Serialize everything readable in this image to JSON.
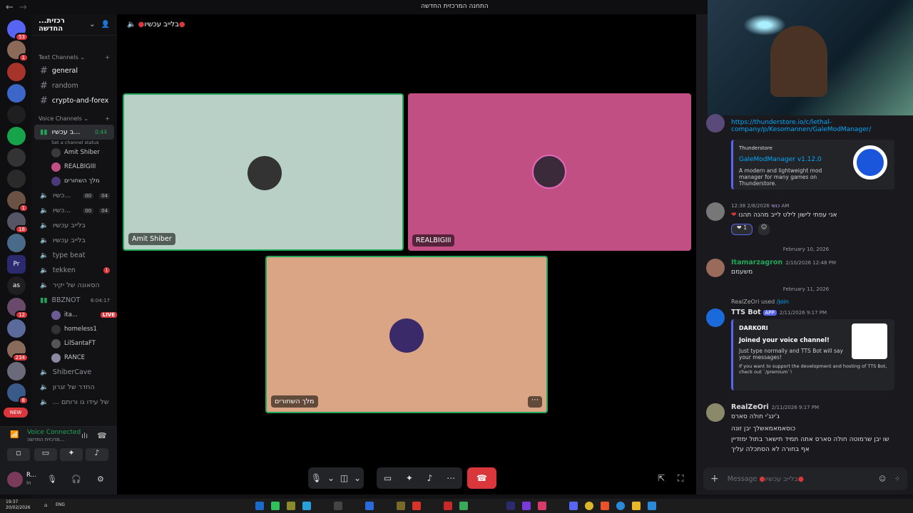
{
  "window": {
    "title": "התחנה המרכזית החדשה"
  },
  "guild_badges": [
    "53",
    "1",
    "1",
    "18",
    "12",
    "234",
    "8"
  ],
  "guild_text": {
    "as": "as",
    "new": "NEW"
  },
  "server": {
    "name": "...רכזית החדשה"
  },
  "categories": {
    "text": "Text Channels",
    "voice": "Voice Channels"
  },
  "text_channels": [
    "general",
    "random",
    "crypto-and-forex"
  ],
  "voice": {
    "active_channel": "ב עכשיו...",
    "active_time": "0:44",
    "status_hint": "Set a channel status",
    "active_users": [
      "Amit Shiber",
      "REALBIGIII",
      "מלך השחורים"
    ],
    "channels": [
      {
        "name": "כשיו...",
        "count": "00",
        "cap": "04"
      },
      {
        "name": "כשיו...",
        "count": "00",
        "cap": "04"
      },
      {
        "name": "בלייב עכשיו"
      },
      {
        "name": "בלייב עכשיו"
      },
      {
        "name": "type beat"
      },
      {
        "name": "tekken",
        "badge": "1"
      },
      {
        "name": "הסאונה של יקיר"
      },
      {
        "name": "BBZNOT",
        "time": "6:04:17"
      }
    ],
    "bbz_users": [
      {
        "name": "ita...",
        "live": "LIVE"
      },
      {
        "name": "homeless1"
      },
      {
        "name": "LilSantaFT"
      },
      {
        "name": "RANCE"
      }
    ],
    "more_channels": [
      "ShiberCave",
      "החדר של זגרון",
      "... של עידו גו ורותם"
    ]
  },
  "voice_connected": {
    "label": "Voice Connected",
    "sub": "מרכזית החדשה..."
  },
  "user": {
    "name": "R...",
    "status": "In"
  },
  "stage": {
    "header": "בלייב עכשיו",
    "tiles": [
      {
        "name": "Amit Shiber",
        "color": "#b8d0c6"
      },
      {
        "name": "REALBIGIII",
        "color": "#c14f84"
      },
      {
        "name": "מלך השחורים",
        "color": "#d9a584"
      }
    ]
  },
  "chat": {
    "link": "https://thunderstore.io/c/lethal-company/p/Kesomannen/GaleModManager/",
    "embed1": {
      "site": "Thunderstore",
      "title": "GaleModManager v1.12.0",
      "desc": "A modern and lightweight mod manager for many games on Thunderstore."
    },
    "msg1": {
      "user": "כושי",
      "time": "2/8/2026 12:38 AM",
      "text": "אני עפתי לישון לילט לייב מהנה תהנו",
      "reaction": "1"
    },
    "date1": "February 10, 2026",
    "msg2": {
      "user": "Itamarzagron",
      "time": "2/10/2026 12:48 PM",
      "text": "משעמם"
    },
    "date2": "February 11, 2026",
    "msg3": {
      "reply_user": "RealZeOri",
      "used": "used",
      "cmd": "/join",
      "user": "TTS Bot",
      "tag": "APP",
      "time": "2/11/2026 9:17 PM"
    },
    "embed2": {
      "author": "DARKORI",
      "title": "Joined your voice channel!",
      "desc": "Just type normally and TTS Bot will say your messages!",
      "note": "If you want to support the development and hosting of TTS Bot, check out `/premium`!"
    },
    "msg4": {
      "user": "RealZeOri",
      "time": "2/11/2026 9:17 PM",
      "lines": [
        "ג'ינג'י חולה סארס",
        "כוסאמאמאשלך יבן זונה",
        "שו יבן שרמוטה חולה סארס אתה תמיד תישאר בתול ימזדיין",
        "אף בחורה לא הסתכלה עליך"
      ]
    },
    "input_placeholder": "Message",
    "input_channel": "בלייב עכשיו"
  },
  "taskbar": {
    "time": "19:37",
    "date": "20/02/2026",
    "lang": "ENG"
  }
}
